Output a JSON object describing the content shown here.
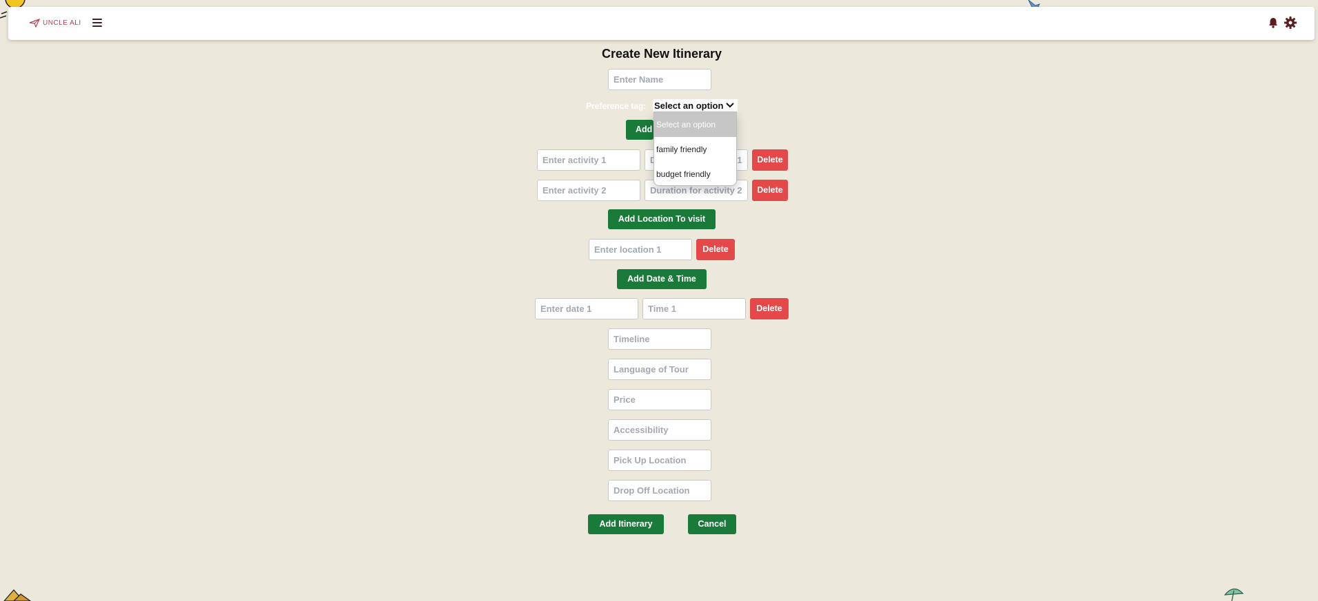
{
  "navbar": {
    "logo_text": "UNCLE ALI",
    "icons": [
      "logo-plane-icon",
      "hamburger-menu-icon",
      "bell-icon",
      "gear-icon"
    ]
  },
  "form": {
    "title": "Create New Itinerary",
    "name_placeholder": "Enter Name",
    "preference_label": "Preference tag:",
    "preference_selected": "Select an option",
    "preference_options": [
      "Select an option",
      "family friendly",
      "budget friendly"
    ],
    "add_activity_label": "Add",
    "activities": [
      {
        "placeholder": "Enter activity 1",
        "duration_placeholder": "Duration for activity 1"
      },
      {
        "placeholder": "Enter activity 2",
        "duration_placeholder": "Duration for activity 2"
      }
    ],
    "delete_label": "Delete",
    "add_location_label": "Add Location To visit",
    "location_placeholder": "Enter location 1",
    "add_datetime_label": "Add Date & Time",
    "date_placeholder": "Enter date 1",
    "time_placeholder": "Time 1",
    "timeline_placeholder": "Timeline",
    "language_placeholder": "Language of Tour",
    "price_placeholder": "Price",
    "accessibility_placeholder": "Accessibility",
    "pickup_placeholder": "Pick Up Location",
    "dropoff_placeholder": "Drop Off Location",
    "submit_label": "Add Itinerary",
    "cancel_label": "Cancel"
  },
  "colors": {
    "background": "#ece9dc",
    "primary_button": "#1a7a3a",
    "delete_button": "#e54848",
    "brand": "#c43a4a"
  }
}
